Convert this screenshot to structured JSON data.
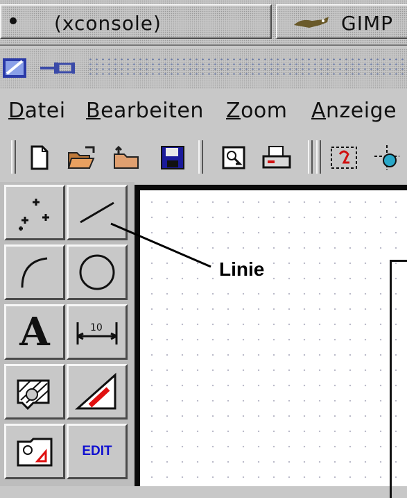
{
  "taskbar": {
    "tasks": [
      {
        "label": "(xconsole)",
        "icon": "bullet-icon"
      },
      {
        "label": "GIMP",
        "icon": "gimp-icon"
      }
    ]
  },
  "titlebar": {
    "icons": [
      "app-icon",
      "pin-icon"
    ]
  },
  "menubar": {
    "items": [
      {
        "label": "Datei",
        "mnemonic": "D"
      },
      {
        "label": "Bearbeiten",
        "mnemonic": "B"
      },
      {
        "label": "Zoom",
        "mnemonic": "Z"
      },
      {
        "label": "Anzeige",
        "mnemonic": "A"
      }
    ]
  },
  "toolbar": {
    "buttons": [
      "new-document-icon",
      "open-folder-icon",
      "folder-icon",
      "save-floppy-icon",
      "print-preview-icon",
      "printer-icon",
      "redraw-icon",
      "snap-icon"
    ]
  },
  "palette": {
    "tools": [
      {
        "name": "points-tool"
      },
      {
        "name": "line-tool"
      },
      {
        "name": "arc-tool"
      },
      {
        "name": "circle-tool"
      },
      {
        "name": "text-tool",
        "glyph": "A"
      },
      {
        "name": "dimension-tool",
        "glyph": "10"
      },
      {
        "name": "hatch-tool"
      },
      {
        "name": "measure-tool"
      },
      {
        "name": "image-tool"
      },
      {
        "name": "edit-tool",
        "glyph": "EDIT"
      }
    ]
  },
  "callout": {
    "label": "Linie"
  },
  "colors": {
    "edit_blue": "#1010d0",
    "accent_red": "#e01010",
    "canvas_border": "#0a0a0a"
  }
}
